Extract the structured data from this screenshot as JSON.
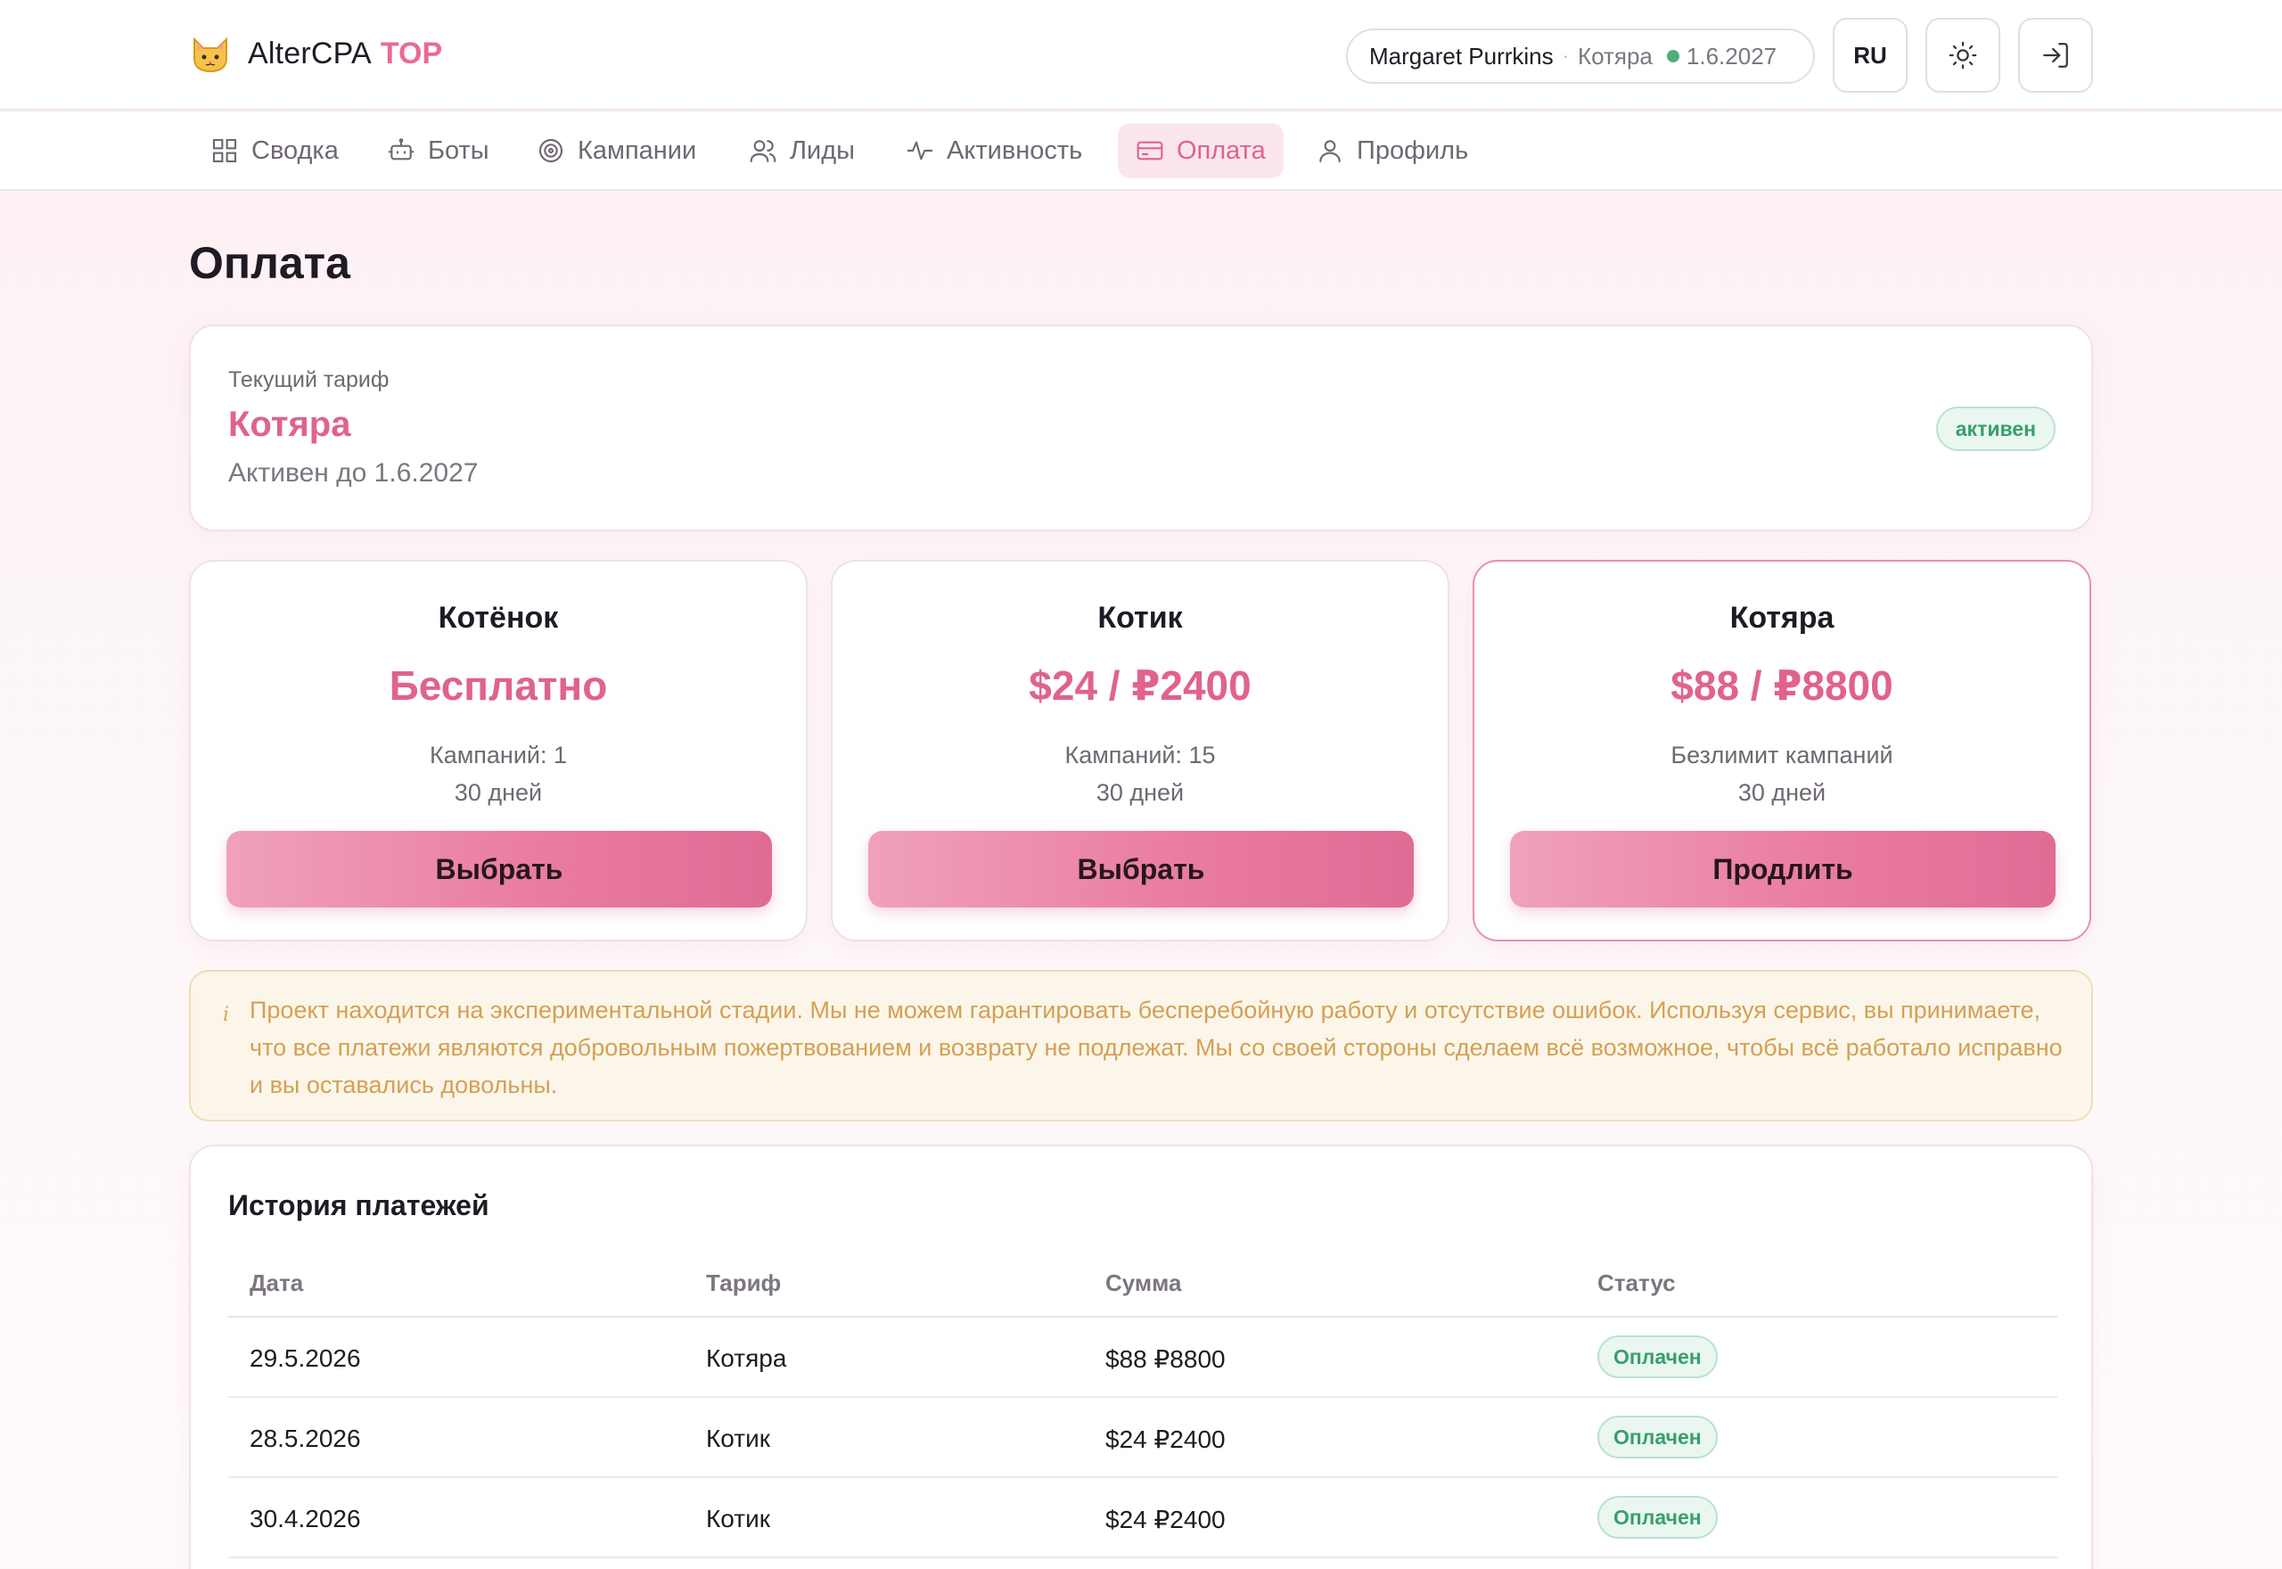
{
  "header": {
    "brand_name": "AlterCPA",
    "brand_badge": "TOP",
    "user": {
      "name": "Margaret Purrkins",
      "separator": "·",
      "plan": "Котяра",
      "expiry": "1.6.2027"
    },
    "lang_label": "RU",
    "icons": {
      "logo": "cat-face-icon",
      "theme": "sun-icon",
      "logout": "sign-in-arrow-icon"
    }
  },
  "nav": {
    "items": [
      {
        "label": "Сводка",
        "icon": "grid-icon"
      },
      {
        "label": "Боты",
        "icon": "bot-icon"
      },
      {
        "label": "Кампании",
        "icon": "target-icon"
      },
      {
        "label": "Лиды",
        "icon": "users-icon"
      },
      {
        "label": "Активность",
        "icon": "activity-icon"
      },
      {
        "label": "Оплата",
        "icon": "credit-card-icon",
        "active": true
      },
      {
        "label": "Профиль",
        "icon": "user-icon"
      }
    ]
  },
  "page": {
    "title": "Оплата"
  },
  "current_plan": {
    "label": "Текущий тариф",
    "name": "Котяра",
    "until": "Активен до 1.6.2027",
    "status": "активен"
  },
  "plans": [
    {
      "name": "Котёнок",
      "price": "Бесплатно",
      "campaigns": "Кампаний: 1",
      "duration": "30 дней",
      "button": "Выбрать"
    },
    {
      "name": "Котик",
      "price": "$24 / ₽2400",
      "campaigns": "Кампаний: 15",
      "duration": "30 дней",
      "button": "Выбрать"
    },
    {
      "name": "Котяра",
      "price": "$88 / ₽8800",
      "campaigns": "Безлимит кампаний",
      "duration": "30 дней",
      "button": "Продлить",
      "featured": true
    }
  ],
  "notice": {
    "icon": "info-icon",
    "text": "Проект находится на экспериментальной стадии. Мы не можем гарантировать бесперебойную работу и отсутствие ошибок. Используя сервис, вы принимаете, что все платежи являются добровольным пожертвованием и возврату не подлежат. Мы со своей стороны сделаем всё возможное, чтобы всё работало исправно и вы оставались довольны."
  },
  "history": {
    "title": "История платежей",
    "columns": [
      "Дата",
      "Тариф",
      "Сумма",
      "Статус"
    ],
    "rows": [
      {
        "date": "29.5.2026",
        "plan": "Котяра",
        "amount": "$88 ₽8800",
        "status": "Оплачен"
      },
      {
        "date": "28.5.2026",
        "plan": "Котик",
        "amount": "$24 ₽2400",
        "status": "Оплачен"
      },
      {
        "date": "30.4.2026",
        "plan": "Котик",
        "amount": "$24 ₽2400",
        "status": "Оплачен"
      }
    ]
  },
  "colors": {
    "accent": "#e0628f",
    "success": "#3a9e6e",
    "warning_text": "#d4a055"
  }
}
